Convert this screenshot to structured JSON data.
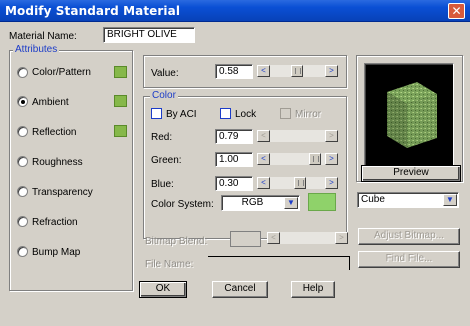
{
  "window": {
    "title": "Modify Standard Material",
    "close_glyph": "✕"
  },
  "material": {
    "label": "Material Name:",
    "value": "BRIGHT OLIVE"
  },
  "attributes": {
    "group_label": "Attributes",
    "items": [
      {
        "label": "Color/Pattern",
        "selected": false,
        "swatch": "#86b84a"
      },
      {
        "label": "Ambient",
        "selected": true,
        "swatch": "#86b84a"
      },
      {
        "label": "Reflection",
        "selected": false,
        "swatch": "#86b84a"
      },
      {
        "label": "Roughness",
        "selected": false
      },
      {
        "label": "Transparency",
        "selected": false
      },
      {
        "label": "Refraction",
        "selected": false
      },
      {
        "label": "Bump Map",
        "selected": false
      }
    ]
  },
  "value": {
    "label": "Value:",
    "text": "0.58"
  },
  "color": {
    "group_label": "Color",
    "by_aci_label": "By ACI",
    "lock_label": "Lock",
    "mirror_label": "Mirror",
    "red_label": "Red:",
    "red_value": "0.79",
    "green_label": "Green:",
    "green_value": "1.00",
    "blue_label": "Blue:",
    "blue_value": "0.30",
    "system_label": "Color System:",
    "system_value": "RGB",
    "swatch": "#8fd26a"
  },
  "preview": {
    "button_label": "Preview",
    "shape_value": "Cube"
  },
  "bitmap": {
    "blend_label": "Bitmap Blend:",
    "file_label": "File Name:",
    "adjust_label": "Adjust Bitmap...",
    "find_label": "Find File..."
  },
  "footer": {
    "ok_label": "OK",
    "cancel_label": "Cancel",
    "help_label": "Help"
  },
  "icons": {
    "left_arrow": "<",
    "right_arrow": ">",
    "down_arrow": "▼"
  }
}
